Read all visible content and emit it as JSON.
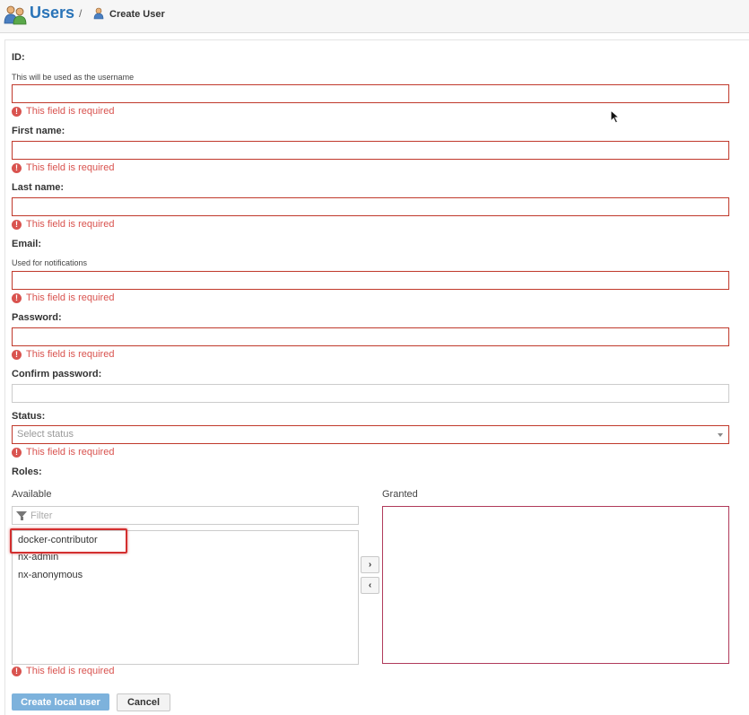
{
  "header": {
    "title": "Users",
    "separator": "/",
    "breadcrumb": "Create User"
  },
  "form": {
    "id": {
      "label": "ID:",
      "help": "This will be used as the username",
      "value": "",
      "error": "This field is required"
    },
    "first_name": {
      "label": "First name:",
      "value": "",
      "error": "This field is required"
    },
    "last_name": {
      "label": "Last name:",
      "value": "",
      "error": "This field is required"
    },
    "email": {
      "label": "Email:",
      "help": "Used for notifications",
      "value": "",
      "error": "This field is required"
    },
    "password": {
      "label": "Password:",
      "value": "",
      "error": "This field is required"
    },
    "confirm_password": {
      "label": "Confirm password:",
      "value": ""
    },
    "status": {
      "label": "Status:",
      "placeholder": "Select status",
      "error": "This field is required"
    },
    "roles": {
      "label": "Roles:",
      "available_label": "Available",
      "granted_label": "Granted",
      "filter_placeholder": "Filter",
      "available": [
        "docker-contributor",
        "nx-admin",
        "nx-anonymous"
      ],
      "granted": [],
      "error": "This field is required",
      "move_right": "›",
      "move_left": "‹"
    }
  },
  "buttons": {
    "create": "Create local user",
    "cancel": "Cancel"
  },
  "colors": {
    "accent": "#2a74b8",
    "error": "#d9534f",
    "primary_button": "#7db2dc",
    "highlight": "#d32f2f"
  },
  "icons": [
    "users-icon",
    "user-icon",
    "error-icon",
    "filter-icon",
    "chevron-right-icon",
    "chevron-left-icon",
    "dropdown-caret-icon",
    "mouse-cursor-icon"
  ]
}
